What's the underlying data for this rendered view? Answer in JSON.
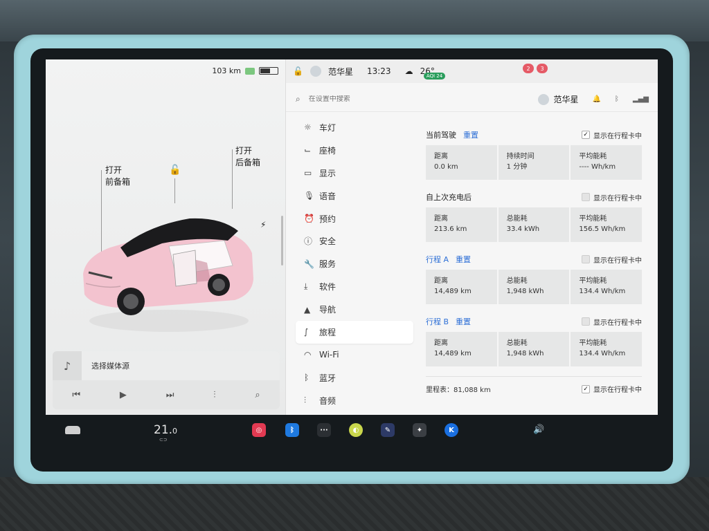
{
  "status": {
    "range": "103 km"
  },
  "car": {
    "frunk_open": "打开",
    "frunk_label": "前备箱",
    "trunk_open": "打开",
    "trunk_label": "后备箱"
  },
  "media": {
    "source_prompt": "选择媒体源"
  },
  "topbar": {
    "user": "范华星",
    "time": "13:23",
    "temperature": "26°",
    "aqi": "AQI 24",
    "pin_a": "2",
    "pin_b": "3"
  },
  "search": {
    "placeholder": "在设置中搜索"
  },
  "profile": {
    "name": "范华星"
  },
  "menu": [
    {
      "label": "车灯",
      "icon": "light-icon"
    },
    {
      "label": "座椅",
      "icon": "seat-icon"
    },
    {
      "label": "显示",
      "icon": "display-icon"
    },
    {
      "label": "语音",
      "icon": "microphone-icon"
    },
    {
      "label": "预约",
      "icon": "alarm-clock-icon"
    },
    {
      "label": "安全",
      "icon": "info-icon"
    },
    {
      "label": "服务",
      "icon": "wrench-icon"
    },
    {
      "label": "软件",
      "icon": "download-icon"
    },
    {
      "label": "导航",
      "icon": "navigation-arrow-icon"
    },
    {
      "label": "旅程",
      "icon": "trip-icon"
    },
    {
      "label": "Wi-Fi",
      "icon": "wifi-icon"
    },
    {
      "label": "蓝牙",
      "icon": "bluetooth-icon"
    },
    {
      "label": "音频",
      "icon": "equalizer-icon"
    }
  ],
  "trip": {
    "current": {
      "title": "当前驾驶",
      "reset": "重置",
      "show_label": "显示在行程卡中",
      "checked": true,
      "cells": [
        {
          "label": "距离",
          "value": "0.0 km"
        },
        {
          "label": "持续时间",
          "value": "1 分钟"
        },
        {
          "label": "平均能耗",
          "value": "---- Wh/km"
        }
      ]
    },
    "since_charge": {
      "title": "自上次充电后",
      "show_label": "显示在行程卡中",
      "checked": false,
      "cells": [
        {
          "label": "距离",
          "value": "213.6 km"
        },
        {
          "label": "总能耗",
          "value": "33.4 kWh"
        },
        {
          "label": "平均能耗",
          "value": "156.5 Wh/km"
        }
      ]
    },
    "trip_a": {
      "title": "行程 A",
      "reset": "重置",
      "show_label": "显示在行程卡中",
      "checked": false,
      "cells": [
        {
          "label": "距离",
          "value": "14,489 km"
        },
        {
          "label": "总能耗",
          "value": "1,948 kWh"
        },
        {
          "label": "平均能耗",
          "value": "134.4 Wh/km"
        }
      ]
    },
    "trip_b": {
      "title": "行程 B",
      "reset": "重置",
      "show_label": "显示在行程卡中",
      "checked": false,
      "cells": [
        {
          "label": "距离",
          "value": "14,489 km"
        },
        {
          "label": "总能耗",
          "value": "1,948 kWh"
        },
        {
          "label": "平均能耗",
          "value": "134.4 Wh/km"
        }
      ]
    },
    "odometer": "里程表：81,088 km",
    "odometer_show_label": "显示在行程卡中",
    "odometer_checked": true
  },
  "taskbar": {
    "temperature_main": "21.",
    "temperature_decimal": "0"
  },
  "colors": {
    "link": "#2d6fd6",
    "car_body": "#f3c3cf",
    "bezel": "#9fd4dc"
  }
}
